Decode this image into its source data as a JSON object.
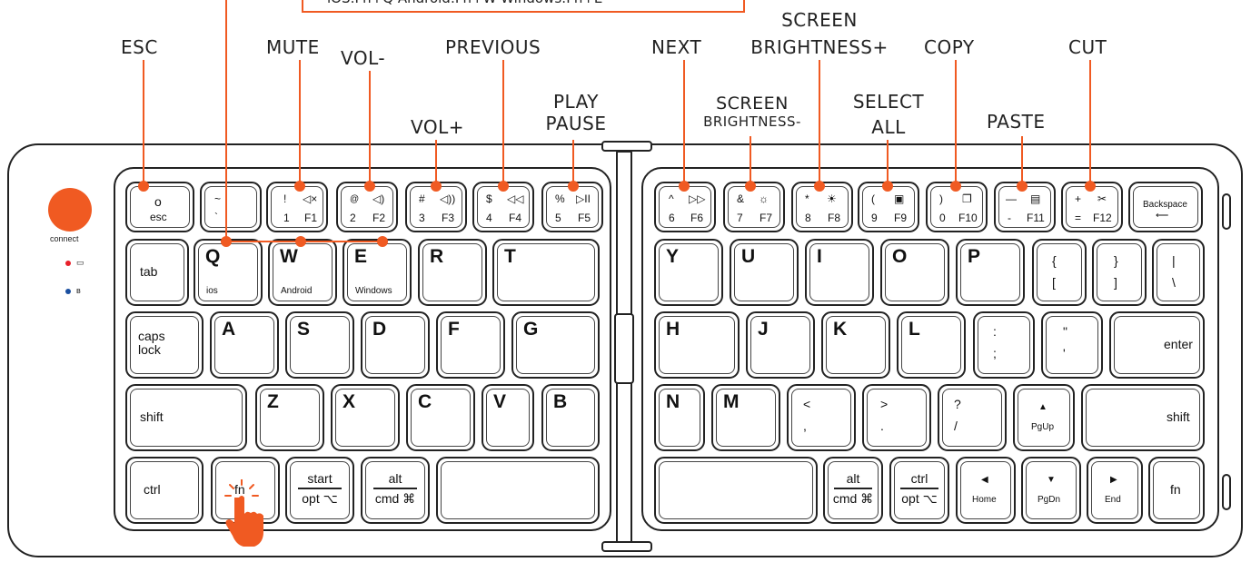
{
  "os_shortcuts": "iOS:Fn+Q    Android:Fn+W    Windows:Fn+E",
  "callouts": {
    "esc": "ESC",
    "mute": "MUTE",
    "vol_down": "VOL-",
    "previous": "PREVIOUS",
    "vol_up": "VOL+",
    "play_pause_1": "PLAY",
    "play_pause_2": "PAUSE",
    "next": "NEXT",
    "bright_down_1": "SCREEN",
    "bright_down_2": "BRIGHTNESS-",
    "bright_up_1": "SCREEN",
    "bright_up_2": "BRIGHTNESS+",
    "select_all_1": "SELECT",
    "select_all_2": "ALL",
    "copy": "COPY",
    "paste": "PASTE",
    "cut": "CUT"
  },
  "connect_label": "connect",
  "accent_color": "#f05a22",
  "led_colors": {
    "power": "#e8202a",
    "bluetooth": "#1a4fa0"
  },
  "icons": [
    "battery-icon",
    "bluetooth-icon",
    "pointing-hand-icon"
  ],
  "keys": {
    "esc": {
      "top": "o",
      "bottom": "esc"
    },
    "tilde": {
      "top": "~",
      "bottom": "`"
    },
    "k1": {
      "tl": "!",
      "tr": "◁×",
      "bl": "1",
      "br": "F1"
    },
    "k2": {
      "tl": "@",
      "tr": "◁)",
      "bl": "2",
      "br": "F2"
    },
    "k3": {
      "tl": "#",
      "tr": "◁))",
      "bl": "3",
      "br": "F3"
    },
    "k4": {
      "tl": "$",
      "tr": "◁◁",
      "bl": "4",
      "br": "F4"
    },
    "k5": {
      "tl": "%",
      "tr": "▷II",
      "bl": "5",
      "br": "F5"
    },
    "k6": {
      "tl": "^",
      "tr": "▷▷",
      "bl": "6",
      "br": "F6"
    },
    "k7": {
      "tl": "&",
      "tr": "☼",
      "bl": "7",
      "br": "F7"
    },
    "k8": {
      "tl": "*",
      "tr": "☀",
      "bl": "8",
      "br": "F8"
    },
    "k9": {
      "tl": "(",
      "tr": "▣",
      "bl": "9",
      "br": "F9"
    },
    "k0": {
      "tl": ")",
      "tr": "❐",
      "bl": "0",
      "br": "F10"
    },
    "kminus": {
      "tl": "—",
      "tr": "▤",
      "bl": "-",
      "br": "F11"
    },
    "kplus": {
      "tl": "+",
      "tr": "✂",
      "bl": "=",
      "br": "F12"
    },
    "backspace": "Backspace",
    "tab": "tab",
    "q": "Q",
    "q_sub": "ios",
    "w": "W",
    "w_sub": "Android",
    "e": "E",
    "e_sub": "Windows",
    "r": "R",
    "t": "T",
    "y": "Y",
    "u": "U",
    "i": "I",
    "o": "O",
    "p": "P",
    "lbrace": {
      "top": "{",
      "bottom": "["
    },
    "rbrace": {
      "top": "}",
      "bottom": "]"
    },
    "pipe": {
      "top": "|",
      "bottom": "\\"
    },
    "caps1": "caps",
    "caps2": "lock",
    "a": "A",
    "s": "S",
    "d": "D",
    "f": "F",
    "g": "G",
    "h": "H",
    "j": "J",
    "k": "K",
    "l": "L",
    "colon": {
      "top": ":",
      "bottom": ";"
    },
    "quote": {
      "top": "\"",
      "bottom": "'"
    },
    "enter": "enter",
    "shift_l": "shift",
    "z": "Z",
    "x": "X",
    "c": "C",
    "v": "V",
    "b": "B",
    "n": "N",
    "m": "M",
    "lt": {
      "top": "<",
      "bottom": ","
    },
    "gt": {
      "top": ">",
      "bottom": "."
    },
    "qmark": {
      "top": "?",
      "bottom": "/"
    },
    "up": {
      "arrow": "▲",
      "label": "PgUp"
    },
    "shift_r": "shift",
    "ctrl_l": "ctrl",
    "fn_l": "fn",
    "start": {
      "top": "start",
      "bottom": "opt ⌥"
    },
    "alt_l": {
      "top": "alt",
      "bottom": "cmd ⌘"
    },
    "alt_r": {
      "top": "alt",
      "bottom": "cmd ⌘"
    },
    "ctrl_r": {
      "top": "ctrl",
      "bottom": "opt ⌥"
    },
    "left": {
      "arrow": "◀",
      "label": "Home"
    },
    "down": {
      "arrow": "▼",
      "label": "PgDn"
    },
    "right": {
      "arrow": "▶",
      "label": "End"
    },
    "fn_r": "fn"
  }
}
